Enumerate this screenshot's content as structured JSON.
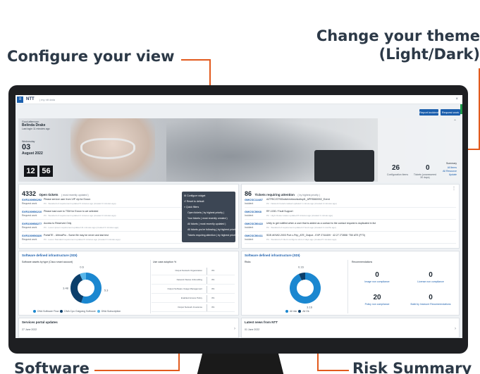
{
  "callouts": {
    "configure": "Configure your view",
    "theme_line1": "Change your theme",
    "theme_line2": "(Light/Dark)",
    "software": "Software",
    "risk": "Risk Summary"
  },
  "app": {
    "logo": "NTT",
    "logo_sub": "| my ntt data",
    "buttons": {
      "report_incident": "Report incident",
      "request_work": "Request work"
    }
  },
  "hero": {
    "greeting": "Good afternoon",
    "user_name": "Belinda Drake",
    "user_sub": "Last login 11 minutes ago",
    "date_label": "Wednesday",
    "day": "03",
    "month_year": "August 2022",
    "clock_hour": "12",
    "clock_min": "56",
    "summary_label": "Summary",
    "stat1_value": "26",
    "stat1_label": "Configuration items",
    "stat2_value": "0",
    "stat2_label": "Tickets (unanswered 30 days)",
    "link1": "All items",
    "link2": "All Resource",
    "link3": "Update"
  },
  "open_tickets": {
    "count": "4332",
    "title": "Open tickets",
    "filter": "( most recently updated )",
    "rows": [
      {
        "id": "SVR100956292",
        "type": "Request work",
        "title": "Please service user from VIP vip for Exxon",
        "sub": "P3 · Standard of requirement updated 5 minutes ago (created 3 minutes ago)"
      },
      {
        "id": "SVR100956210",
        "type": "Request work",
        "title": "Please load user to TSM for Exxon to we selected",
        "sub": "P3 · Standard of requirement updated 2 minutes ago (created 3 minutes ago)"
      },
      {
        "id": "SVR100958277",
        "type": "Request work",
        "title": "Access to Reserved Only",
        "sub": "P3 · Lorem Ipsum requirement updated 41 minutes ago (created 3 minutes ago)"
      },
      {
        "id": "SVR100956820",
        "type": "Request work",
        "title": "PortalTE - UltimaPro - Some file may be never and last test",
        "sub": "P3 · Lorem Standard requirement updated 6 minutes ago (created 3 minutes ago)"
      }
    ]
  },
  "view_menu": {
    "items": [
      "Configure widget",
      "Reset to default",
      "Quick filters",
      "Open tickets ( by highest priority )",
      "Your tickets ( most recently created )",
      "All tickets ( most recently updated )",
      "All tickets you're following ( by highest priority )",
      "Tickets requiring attention ( by highest priority )"
    ]
  },
  "attention": {
    "count": "86",
    "title": "Tickets requiring attention",
    "filter": "( by highest priority )",
    "rows": [
      {
        "id": "GMCSC11487",
        "type": "Incident",
        "title": "AZTRIC/GTNSwitch/networkcdlspf1_APRS660002_Event",
        "sub": "P2 · Network Ceteris tasked updated 1 minute ago (created 2 minutes ago)"
      },
      {
        "id": "GMCSC5068",
        "type": "Incident",
        "title": "RF-1030 / Fault Support",
        "sub": "P2 · High Cluster status updated 8 minutes ago (created 1 minute ago)"
      },
      {
        "id": "GMCSC50422",
        "type": "Incident",
        "title": "Unity to get notified when a user that is added as a contact to the contact request is duplicated in list",
        "sub": "P2 · Standard of requirement updated 2 hours ago (created 4 months ago)"
      },
      {
        "id": "GMCSC50411",
        "type": "Incident",
        "title": "SDE-MXW2-2003 Port c-Pep_ATE_Output - EXP 2744409 · 42.27 2°2858 ·T50 ATE (P73)",
        "sub": "P3 · Standard of Client configure since 2 days ago (created 5 minutes ago)"
      }
    ]
  },
  "sdi_left": {
    "title": "Software defined infrastructure (SDI)",
    "chart_title": "Software assets by type (Cisco smart account)",
    "adoption_title": "Use case adoption %",
    "adoption": [
      {
        "name": "Output Network Organization",
        "value": "3%"
      },
      {
        "name": "Network Status Unbundling",
        "value": "3%"
      },
      {
        "name": "Output Software Usage Management",
        "value": "3%"
      },
      {
        "name": "Enabled Access Policy",
        "value": "3%"
      },
      {
        "name": "Output Network Insurance",
        "value": "3%"
      }
    ]
  },
  "sdi_right": {
    "title": "Software defined infrastructure (SDI)",
    "risk_title": "Risks",
    "rec_title": "Recommendations",
    "recs": [
      {
        "value": "0",
        "label": "Image non compliance"
      },
      {
        "value": "0",
        "label": "License non compliance"
      },
      {
        "value": "20",
        "label": "Policy non compliance"
      },
      {
        "value": "0",
        "label": "Build by Insecure Recommendations"
      }
    ]
  },
  "portal_updates": {
    "title": "Services portal updates",
    "date": "27 June 2022"
  },
  "latest_news": {
    "title": "Latest news from NTT",
    "date": "01 June 2022"
  },
  "chart_data": [
    {
      "type": "pie",
      "title": "Software assets by type (Cisco smart account)",
      "series": [
        {
          "name": "DNA Software Flow",
          "value": 5.02,
          "color": "#1b87d0"
        },
        {
          "name": "DNA Cpo Outgoing Software",
          "value": 3.5,
          "color": "#0b3f6b"
        },
        {
          "name": "DNA Subscription",
          "value": 0.6,
          "color": "#58b6ea"
        }
      ],
      "labels": [
        "5.3",
        "3.48",
        "0.6"
      ]
    },
    {
      "type": "pie",
      "title": "Risks",
      "series": [
        {
          "name": "All risk",
          "value": 4.16,
          "color": "#1b87d0"
        },
        {
          "name": "All Ok",
          "value": 0.3,
          "color": "#0b3f6b"
        }
      ],
      "labels": [
        "3.16",
        "0.16"
      ]
    }
  ]
}
